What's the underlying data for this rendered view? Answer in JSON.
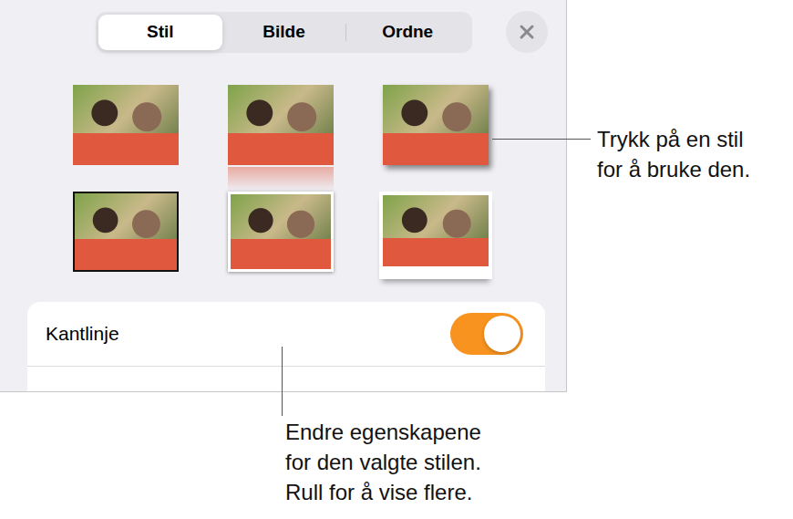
{
  "tabs": [
    {
      "label": "Stil",
      "selected": true
    },
    {
      "label": "Bilde",
      "selected": false
    },
    {
      "label": "Ordne",
      "selected": false
    }
  ],
  "styles": [
    {
      "kind": "plain"
    },
    {
      "kind": "reflection"
    },
    {
      "kind": "shadow"
    },
    {
      "kind": "border"
    },
    {
      "kind": "frame"
    },
    {
      "kind": "curl"
    }
  ],
  "settings": [
    {
      "label": "Kantlinje",
      "kind": "toggle",
      "on": true
    }
  ],
  "callouts": [
    {
      "target": "styles",
      "lines": [
        "Trykk på en stil",
        "for å bruke den."
      ]
    },
    {
      "target": "settings",
      "lines": [
        "Endre egenskapene",
        "for den valgte stilen.",
        "Rull for å vise flere."
      ]
    }
  ]
}
